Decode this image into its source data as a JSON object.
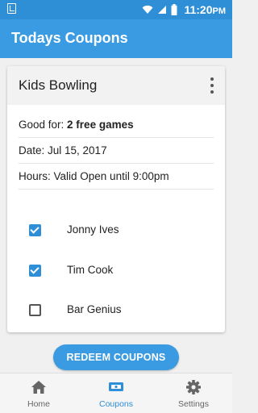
{
  "status_bar": {
    "time": "11:20",
    "time_suffix": "PM"
  },
  "app_bar": {
    "title": "Todays Coupons"
  },
  "coupon": {
    "title": "Kids Bowling",
    "good_for_label": "Good for:",
    "good_for_value": "2 free games",
    "date": "Date: Jul 15, 2017",
    "hours": "Hours: Valid Open until 9:00pm",
    "people": [
      {
        "name": "Jonny Ives",
        "checked": true
      },
      {
        "name": "Tim Cook",
        "checked": true
      },
      {
        "name": "Bar Genius",
        "checked": false
      }
    ]
  },
  "redeem_button": {
    "label": "REDEEM COUPONS"
  },
  "bottom_nav": {
    "items": [
      {
        "label": "Home",
        "icon": "home-icon",
        "active": false
      },
      {
        "label": "Coupons",
        "icon": "coupon-icon",
        "active": true
      },
      {
        "label": "Settings",
        "icon": "gear-icon",
        "active": false
      }
    ]
  },
  "colors": {
    "status_bar": "#2e8ed6",
    "app_bar": "#3a9be2",
    "accent": "#2e8ed6",
    "inactive": "#666666"
  }
}
